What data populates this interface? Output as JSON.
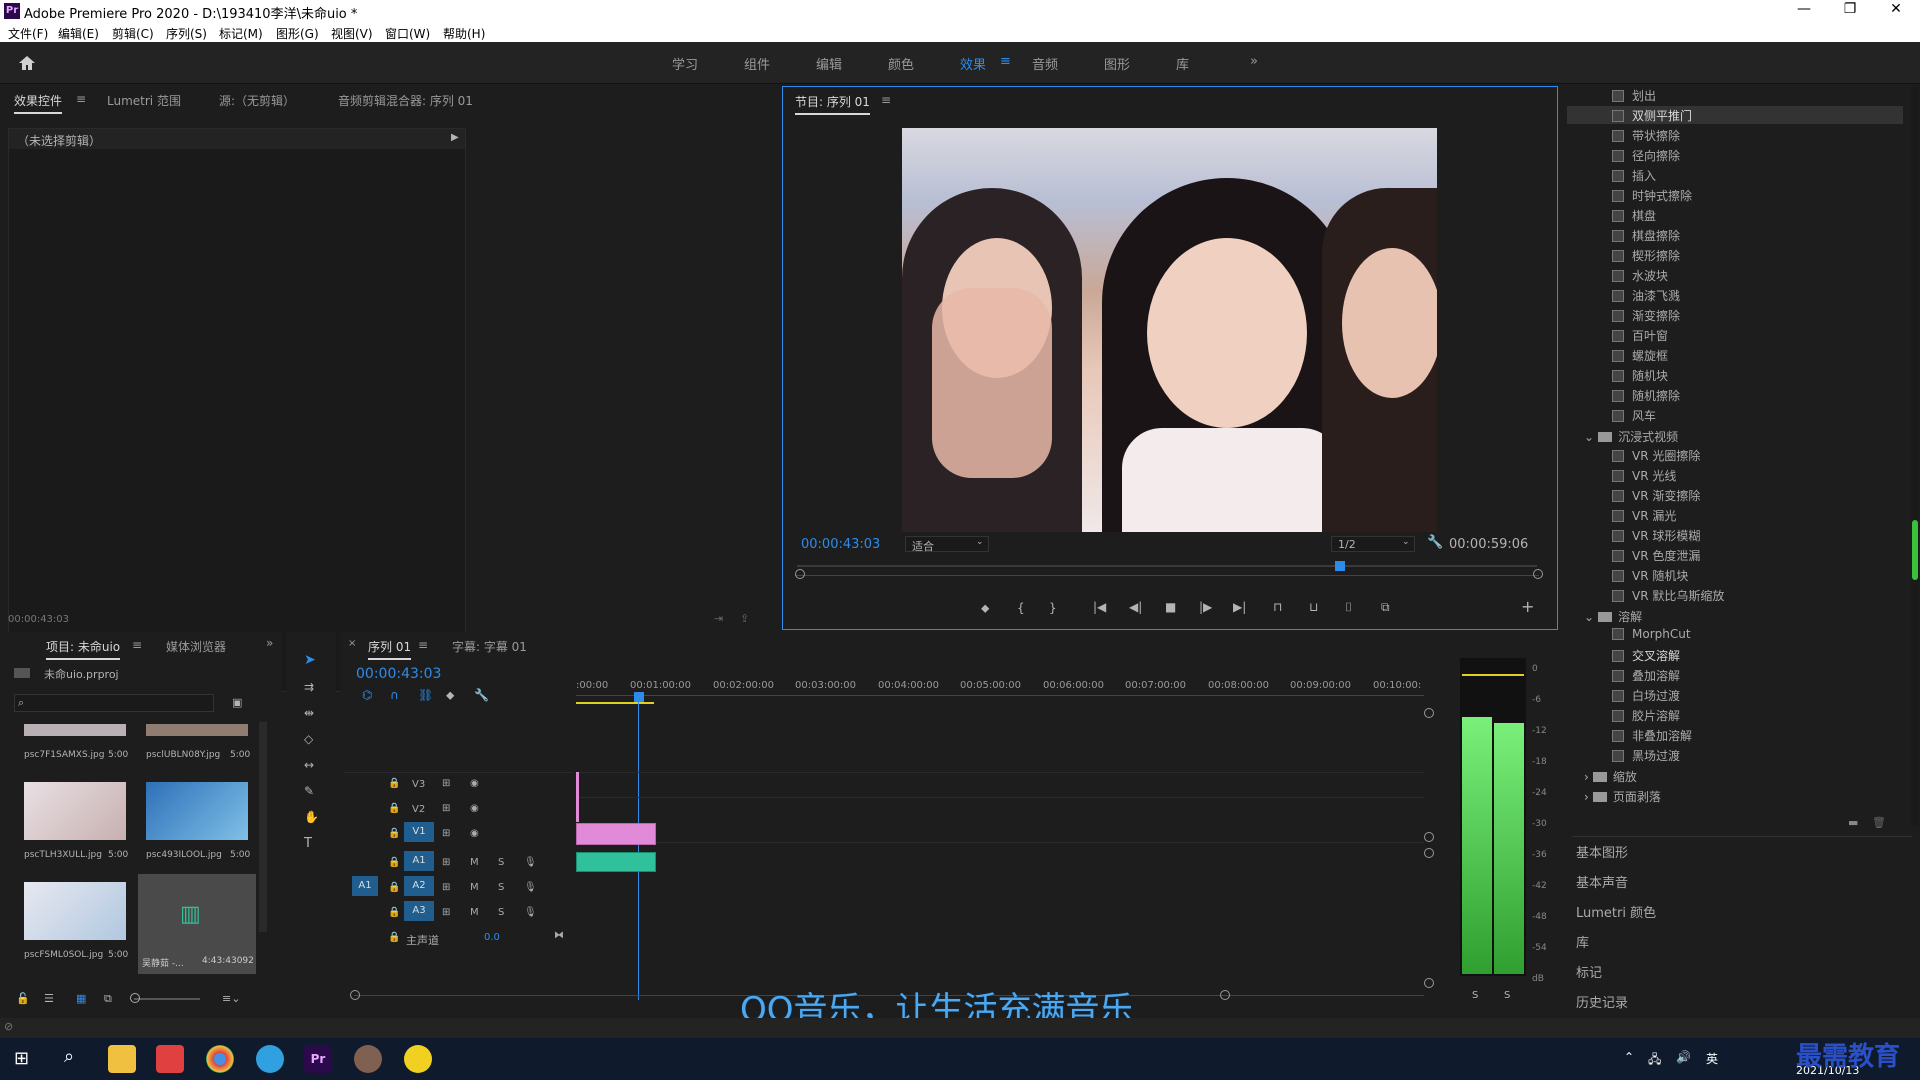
{
  "app": {
    "logo": "Pr",
    "title": "Adobe Premiere Pro 2020 - D:\\193410李洋\\未命uio *"
  },
  "menu": [
    "文件(F)",
    "编辑(E)",
    "剪辑(C)",
    "序列(S)",
    "标记(M)",
    "图形(G)",
    "视图(V)",
    "窗口(W)",
    "帮助(H)"
  ],
  "workspaces": [
    "学习",
    "组件",
    "编辑",
    "颜色",
    "效果",
    "音频",
    "图形",
    "库"
  ],
  "active_workspace": "效果",
  "source_panel": {
    "tabs": [
      "效果控件",
      "Lumetri 范围",
      "源:（无剪辑）",
      "音频剪辑混合器: 序列 01"
    ],
    "no_clip": "（未选择剪辑）",
    "timecode": "00:00:43:03"
  },
  "program_monitor": {
    "tab": "节目: 序列 01",
    "timecode": "00:00:43:03",
    "fit": "适合",
    "resolution": "1/2",
    "duration": "00:00:59:06"
  },
  "effects": {
    "items_top": [
      "划出",
      "双侧平推门",
      "带状擦除",
      "径向擦除",
      "插入",
      "时钟式擦除",
      "棋盘",
      "棋盘擦除",
      "楔形擦除",
      "水波块",
      "油漆飞溅",
      "渐变擦除",
      "百叶窗",
      "螺旋框",
      "随机块",
      "随机擦除",
      "风车"
    ],
    "folder_vr": "沉浸式视频",
    "items_vr": [
      "VR 光圈擦除",
      "VR 光线",
      "VR 渐变擦除",
      "VR 漏光",
      "VR 球形模糊",
      "VR 色度泄漏",
      "VR 随机块",
      "VR 默比乌斯缩放"
    ],
    "folder_dissolve": "溶解",
    "items_dissolve": [
      "MorphCut",
      "交叉溶解",
      "叠加溶解",
      "白场过渡",
      "胶片溶解",
      "非叠加溶解",
      "黑场过渡"
    ],
    "folder_zoom": "缩放",
    "folder_page": "页面剥落",
    "sections": [
      "基本图形",
      "基本声音",
      "Lumetri 颜色",
      "库",
      "标记",
      "历史记录"
    ]
  },
  "project_panel": {
    "tabs": [
      "项目: 未命uio",
      "媒体浏览器"
    ],
    "file": "未命uio.prproj",
    "items": [
      {
        "name": "psc7F1SAMXS.jpg",
        "dur": "5:00"
      },
      {
        "name": "psclUBLN08Y.jpg",
        "dur": "5:00"
      },
      {
        "name": "pscTLH3XULL.jpg",
        "dur": "5:00"
      },
      {
        "name": "psc493ILOOL.jpg",
        "dur": "5:00"
      },
      {
        "name": "pscFSML0SOL.jpg",
        "dur": "5:00"
      },
      {
        "name": "吴静茹 -...",
        "dur": "4:43:43092"
      }
    ]
  },
  "timeline": {
    "tabs": [
      "序列 01",
      "字幕: 字幕 01"
    ],
    "timecode": "00:00:43:03",
    "ruler": [
      ":00:00",
      "00:01:00:00",
      "00:02:00:00",
      "00:03:00:00",
      "00:04:00:00",
      "00:05:00:00",
      "00:06:00:00",
      "00:07:00:00",
      "00:08:00:00",
      "00:09:00:00",
      "00:10:00:"
    ],
    "video_tracks": [
      "V3",
      "V2",
      "V1"
    ],
    "audio_tracks": [
      "A1",
      "A2",
      "A3"
    ],
    "source_patch": "A1",
    "master": "主声道",
    "master_value": "0.0",
    "m": "M",
    "s": "S"
  },
  "meter": {
    "labels": [
      "0",
      "-6",
      "-12",
      "-18",
      "-24",
      "-30",
      "-36",
      "-42",
      "-48",
      "-54",
      "dB"
    ],
    "levels": [
      0.82,
      0.8
    ],
    "s": "S"
  },
  "overlay_caption": "QQ音乐，让生活充满音乐",
  "watermark": "最需教育",
  "taskbar": {
    "date": "2021/10/13",
    "ime": "英"
  },
  "colors": {
    "accent": "#2d8ceb",
    "video_clip": "#e08ad8",
    "audio_clip": "#2fc19b",
    "meter": "#3fcf3f"
  }
}
